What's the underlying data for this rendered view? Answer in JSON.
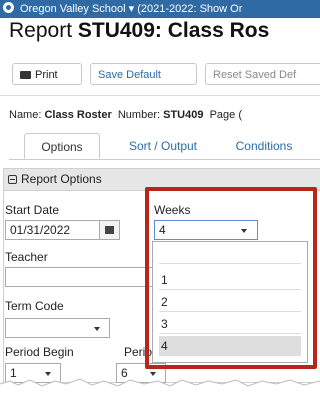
{
  "titlebar": {
    "text": "Oregon Valley School ▾ (2021-2022: Show Or"
  },
  "report": {
    "prefix": "Report ",
    "code_title": "STU409: Class Ros"
  },
  "toolbar": {
    "print_label": "Print",
    "save_default_label": "Save Default",
    "reset_label": "Reset Saved Def"
  },
  "namebar": {
    "name_label": "Name: ",
    "name_value": "Class Roster",
    "number_label": "Number: ",
    "number_value": "STU409",
    "page_label": "Page ("
  },
  "tabs": [
    {
      "label": "Options"
    },
    {
      "label": "Sort / Output"
    },
    {
      "label": "Conditions"
    }
  ],
  "panel": {
    "title": "Report Options"
  },
  "form": {
    "start_date_label": "Start Date",
    "start_date_value": "01/31/2022",
    "weeks_label": "Weeks",
    "weeks_value": "4",
    "teacher_label": "Teacher",
    "term_code_label": "Term Code",
    "period_begin_label": "Period Begin",
    "period_end_label": "Perio",
    "period_begin_value": "1",
    "period_end_value": "6"
  },
  "weeks_options": [
    "",
    "1",
    "2",
    "3",
    "4"
  ],
  "weeks_selected": "4",
  "colors": {
    "brand": "#2f6aa4",
    "highlight_border": "#b5261e",
    "link": "#2f6aa4"
  }
}
